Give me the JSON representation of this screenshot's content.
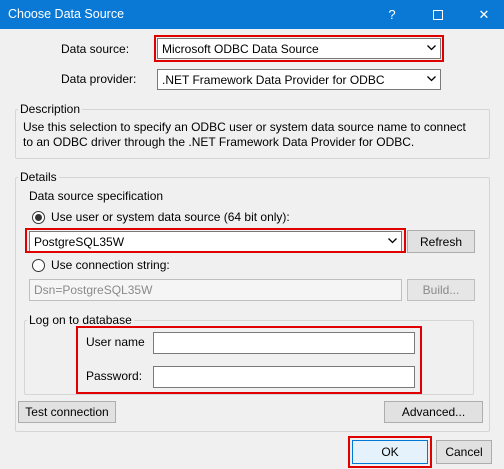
{
  "window": {
    "title": "Choose Data Source",
    "help_glyph": "?",
    "close_glyph": "✕"
  },
  "data_source": {
    "label": "Data source:",
    "value": "Microsoft ODBC Data Source"
  },
  "data_provider": {
    "label": "Data provider:",
    "value": ".NET Framework Data Provider for ODBC"
  },
  "description": {
    "title": "Description",
    "line1": "Use this selection to specify an ODBC user or system data source name to connect",
    "line2": "to an ODBC driver through the .NET Framework Data Provider for ODBC."
  },
  "details": {
    "title": "Details",
    "spec_title": "Data source specification",
    "use_dsn_label": "Use user or system data source (64 bit only):",
    "dsn_value": "PostgreSQL35W",
    "refresh_label": "Refresh",
    "use_conn_label": "Use connection string:",
    "conn_value": "Dsn=PostgreSQL35W",
    "build_label": "Build...",
    "logon_title": "Log on to database",
    "username_label": "User name",
    "username_value": "",
    "password_label": "Password:",
    "password_value": ""
  },
  "buttons": {
    "test_connection": "Test connection",
    "advanced": "Advanced...",
    "ok": "OK",
    "cancel": "Cancel"
  },
  "icons": {
    "dropdown": "chevron-down-icon"
  }
}
